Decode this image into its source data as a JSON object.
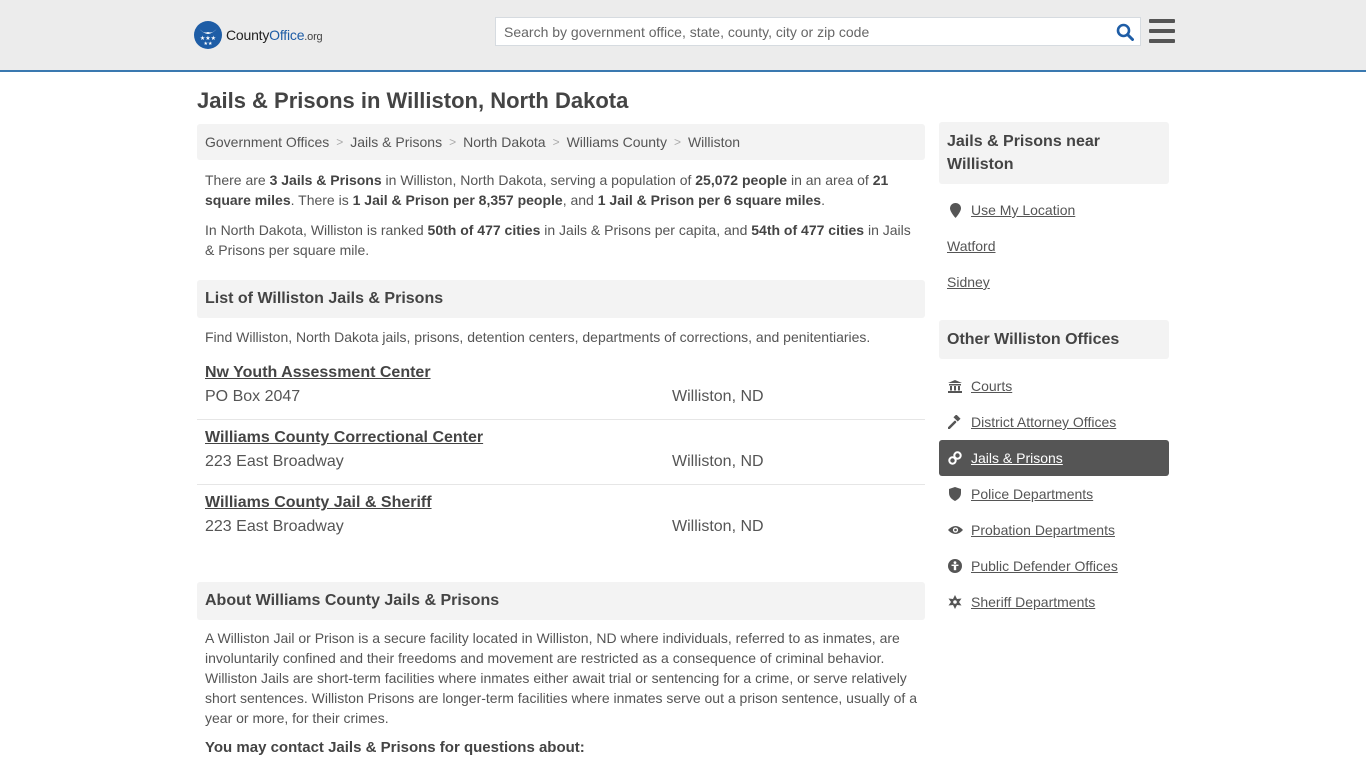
{
  "header": {
    "logo": {
      "brand_prefix": "County",
      "brand_highlight": "Office",
      "brand_tld": ".org"
    },
    "search": {
      "placeholder": "Search by government office, state, county, city or zip code",
      "value": ""
    },
    "icons": {
      "search": "search-icon",
      "menu": "hamburger-menu-icon"
    }
  },
  "page": {
    "title": "Jails & Prisons in Williston, North Dakota"
  },
  "breadcrumb": [
    "Government Offices",
    "Jails & Prisons",
    "North Dakota",
    "Williams County",
    "Williston"
  ],
  "summary": {
    "p1": {
      "t1": "There are ",
      "b1": "3 Jails & Prisons",
      "t2": " in Williston, North Dakota, serving a population of ",
      "b2": "25,072 people",
      "t3": " in an area of ",
      "b3": "21 square miles",
      "t4": ". There is ",
      "b4": "1 Jail & Prison per 8,357 people",
      "t5": ", and ",
      "b5": "1 Jail & Prison per 6 square miles",
      "t6": "."
    },
    "p2": {
      "t1": "In North Dakota, Williston is ranked ",
      "b1": "50th of 477 cities",
      "t2": " in Jails & Prisons per capita, and ",
      "b2": "54th of 477 cities",
      "t3": " in Jails & Prisons per square mile."
    }
  },
  "list_section": {
    "heading": "List of Williston Jails & Prisons",
    "intro": "Find Williston, North Dakota jails, prisons, detention centers, departments of corrections, and penitentiaries.",
    "items": [
      {
        "name": "Nw Youth Assessment Center",
        "address": "PO Box 2047",
        "city": "Williston, ND"
      },
      {
        "name": "Williams County Correctional Center",
        "address": "223 East Broadway",
        "city": "Williston, ND"
      },
      {
        "name": "Williams County Jail & Sheriff",
        "address": "223 East Broadway",
        "city": "Williston, ND"
      }
    ]
  },
  "about_section": {
    "heading": "About Williams County Jails & Prisons",
    "body": "A Williston Jail or Prison is a secure facility located in Williston, ND where individuals, referred to as inmates, are involuntarily confined and their freedoms and movement are restricted as a consequence of criminal behavior. Williston Jails are short-term facilities where inmates either await trial or sentencing for a crime, or serve relatively short sentences. Williston Prisons are longer-term facilities where inmates serve out a prison sentence, usually of a year or more, for their crimes.",
    "contact_heading": "You may contact Jails & Prisons for questions about:"
  },
  "sidebar": {
    "nearby": {
      "heading": "Jails & Prisons near Williston",
      "use_location": {
        "label": "Use My Location",
        "icon": "map-marker-icon"
      },
      "places": [
        "Watford",
        "Sidney"
      ]
    },
    "other_offices": {
      "heading": "Other Williston Offices",
      "items": [
        {
          "label": "Courts",
          "icon": "courthouse-icon",
          "active": false
        },
        {
          "label": "District Attorney Offices",
          "icon": "gavel-icon",
          "active": false
        },
        {
          "label": "Jails & Prisons",
          "icon": "handcuffs-icon",
          "active": true
        },
        {
          "label": "Police Departments",
          "icon": "shield-icon",
          "active": false
        },
        {
          "label": "Probation Departments",
          "icon": "eye-icon",
          "active": false
        },
        {
          "label": "Public Defender Offices",
          "icon": "person-icon",
          "active": false
        },
        {
          "label": "Sheriff Departments",
          "icon": "star-badge-icon",
          "active": false
        }
      ]
    }
  },
  "colors": {
    "accent_blue": "#3a79b0",
    "logo_blue": "#1e5da6",
    "header_bg": "#ececec",
    "panel_bg": "#f3f3f3",
    "active_bg": "#555555"
  }
}
